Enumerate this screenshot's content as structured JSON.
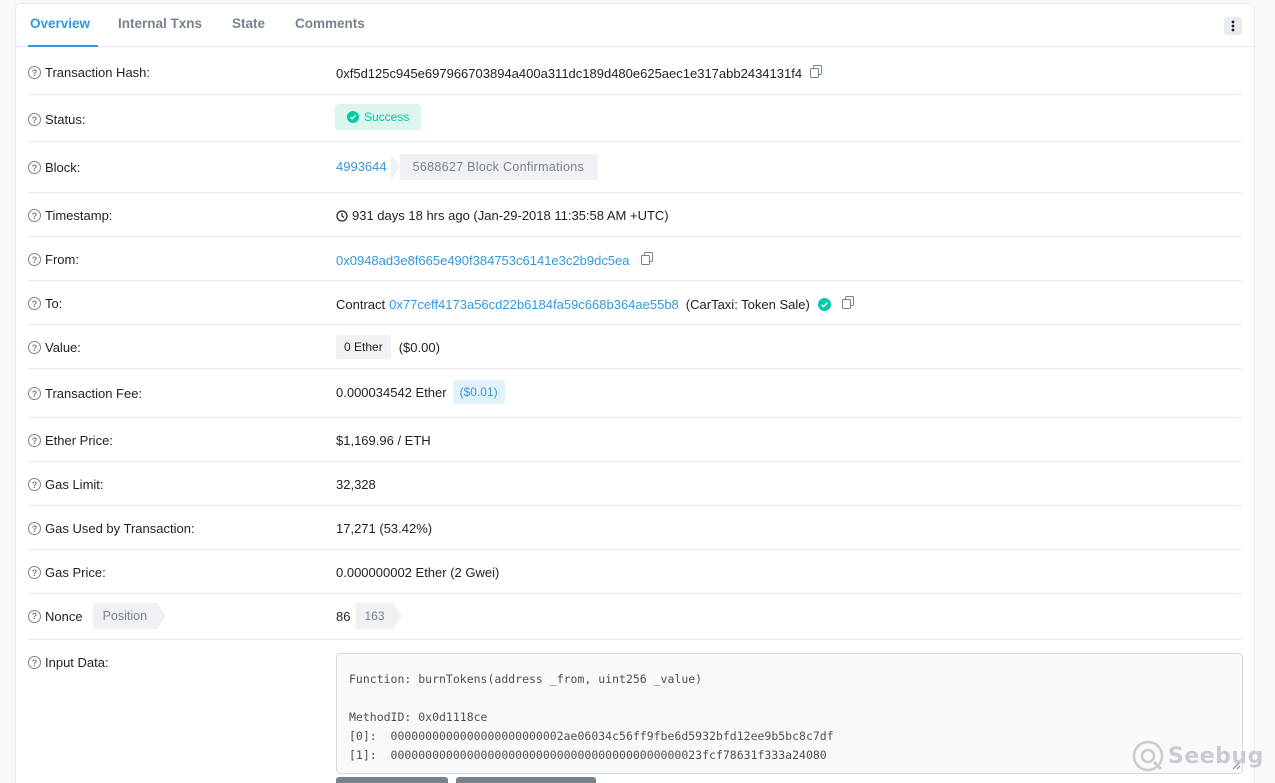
{
  "tabs": [
    {
      "label": "Overview",
      "active": true
    },
    {
      "label": "Internal Txns",
      "active": false
    },
    {
      "label": "State",
      "active": false
    },
    {
      "label": "Comments",
      "active": false
    }
  ],
  "rows": {
    "tx_hash": {
      "label": "Transaction Hash:",
      "value": "0xf5d125c945e697966703894a400a311dc189d480e625aec1e317abb2434131f4"
    },
    "status": {
      "label": "Status:",
      "value": "Success"
    },
    "block": {
      "label": "Block:",
      "number": "4993644",
      "confirmations": "5688627 Block Confirmations"
    },
    "timestamp": {
      "label": "Timestamp:",
      "value": "931 days 18 hrs ago (Jan-29-2018 11:35:58 AM +UTC)"
    },
    "from": {
      "label": "From:",
      "address": "0x0948ad3e8f665e490f384753c6141e3c2b9dc5ea"
    },
    "to": {
      "label": "To:",
      "prefix": "Contract",
      "address": "0x77ceff4173a56cd22b6184fa59c668b364ae55b8",
      "name": "(CarTaxi: Token Sale)"
    },
    "value": {
      "label": "Value:",
      "ether": "0 Ether",
      "usd": "($0.00)"
    },
    "tx_fee": {
      "label": "Transaction Fee:",
      "ether": "0.000034542 Ether",
      "usd": "($0.01)"
    },
    "ether_price": {
      "label": "Ether Price:",
      "value": "$1,169.96 / ETH"
    },
    "gas_limit": {
      "label": "Gas Limit:",
      "value": "32,328"
    },
    "gas_used": {
      "label": "Gas Used by Transaction:",
      "value": "17,271 (53.42%)"
    },
    "gas_price": {
      "label": "Gas Price:",
      "value": "0.000000002 Ether (2 Gwei)"
    },
    "nonce": {
      "label": "Nonce",
      "position_label": "Position",
      "value": "86",
      "position": "163"
    },
    "input_data": {
      "label": "Input Data:",
      "lines": [
        "Function: burnTokens(address _from, uint256 _value)",
        "",
        "MethodID: 0x0d1118ce",
        "[0]:  0000000000000000000000002ae06034c56ff9fbe6d5932bfd12ee9b5bc8c7df",
        "[1]:  000000000000000000000000000000000000000000023fcf78631f333a24080"
      ]
    }
  },
  "watermark": "Seebug",
  "colors": {
    "accent": "#3498db",
    "success": "#00c9a7",
    "success_bg": "#dcf5ef",
    "muted": "#77838f",
    "border": "#e7eaf3"
  }
}
